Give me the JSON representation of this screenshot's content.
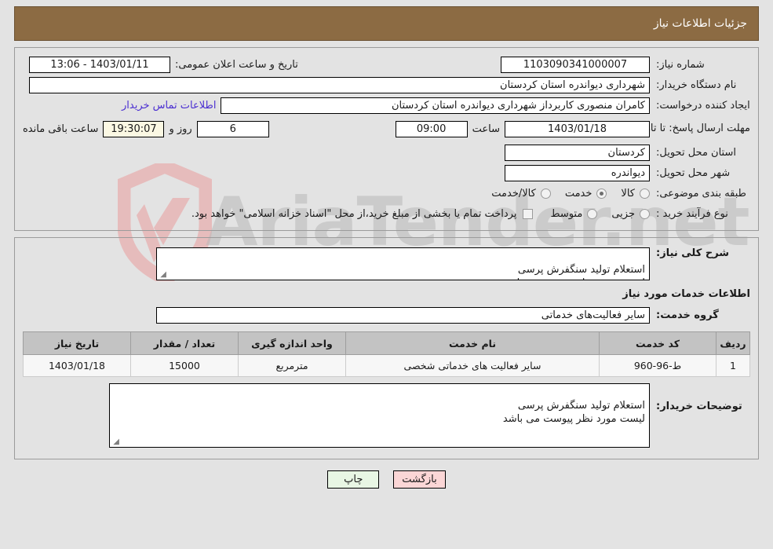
{
  "header": {
    "title": "جزئیات اطلاعات نیاز",
    "bg_color": "#8c6b43",
    "text_color": "#ffffff"
  },
  "watermark": {
    "text": "AriaTender",
    "suffix": ".net",
    "shield_color": "#e8bfbf",
    "text_color": "#b9b9b9"
  },
  "form": {
    "need_number_label": "شماره نیاز:",
    "need_number_value": "1103090341000007",
    "announce_datetime_label": "تاریخ و ساعت اعلان عمومی:",
    "announce_datetime_value": "1403/01/11 - 13:06",
    "buyer_org_label": "نام دستگاه خریدار:",
    "buyer_org_value": "شهرداری دیواندره استان کردستان",
    "requester_label": "ایجاد کننده درخواست:",
    "requester_value": "کامران منصوری کاربرداز شهرداری دیواندره استان کردستان",
    "contact_link": "اطلاعات تماس خریدار",
    "deadline_label": "مهلت ارسال پاسخ: تا تاریخ:",
    "deadline_date": "1403/01/18",
    "hour_label": "ساعت",
    "deadline_time": "09:00",
    "days_value": "6",
    "days_unit": "روز و",
    "countdown_value": "19:30:07",
    "countdown_unit": "ساعت باقی مانده",
    "province_label": "استان محل تحویل:",
    "province_value": "کردستان",
    "city_label": "شهر محل تحویل:",
    "city_value": "دیواندره",
    "category_label": "طبقه بندی موضوعی:",
    "category_options": [
      {
        "label": "کالا",
        "selected": false
      },
      {
        "label": "خدمت",
        "selected": true
      },
      {
        "label": "کالا/خدمت",
        "selected": false
      }
    ],
    "process_label": "نوع فرآیند خرید :",
    "process_options": [
      {
        "label": "جزیی",
        "selected": false
      },
      {
        "label": "متوسط",
        "selected": false
      }
    ],
    "treasury_checkbox_label": "پرداخت تمام یا بخشی از مبلغ خرید،از محل \"اسناد خزانه اسلامی\" خواهد بود.",
    "treasury_checked": false
  },
  "details": {
    "general_desc_label": "شرح کلی نیاز:",
    "general_desc_value": "استعلام تولید سنگفرش پرسی\nلیست مورد نظر پیوست می باشد",
    "services_heading": "اطلاعات خدمات مورد نیاز",
    "service_group_label": "گروه خدمت:",
    "service_group_value": "سایر فعالیت‌های خدماتی",
    "buyer_notes_label": "توضیحات خریدار:",
    "buyer_notes_value": "استعلام تولید سنگفرش پرسی\nلیست مورد نظر پیوست می باشد",
    "resize_grip": "◢"
  },
  "table": {
    "columns": [
      "ردیف",
      "کد خدمت",
      "نام خدمت",
      "واحد اندازه گیری",
      "تعداد / مقدار",
      "تاریخ نیاز"
    ],
    "rows": [
      {
        "index": "1",
        "code": "ط-96-960",
        "name": "سایر فعالیت های خدماتی شخصی",
        "unit": "مترمربع",
        "quantity": "15000",
        "date": "1403/01/18"
      }
    ]
  },
  "footer": {
    "print_label": "چاپ",
    "back_label": "بازگشت",
    "print_bg": "#e8f6e4",
    "back_bg": "#fbd6d6"
  }
}
